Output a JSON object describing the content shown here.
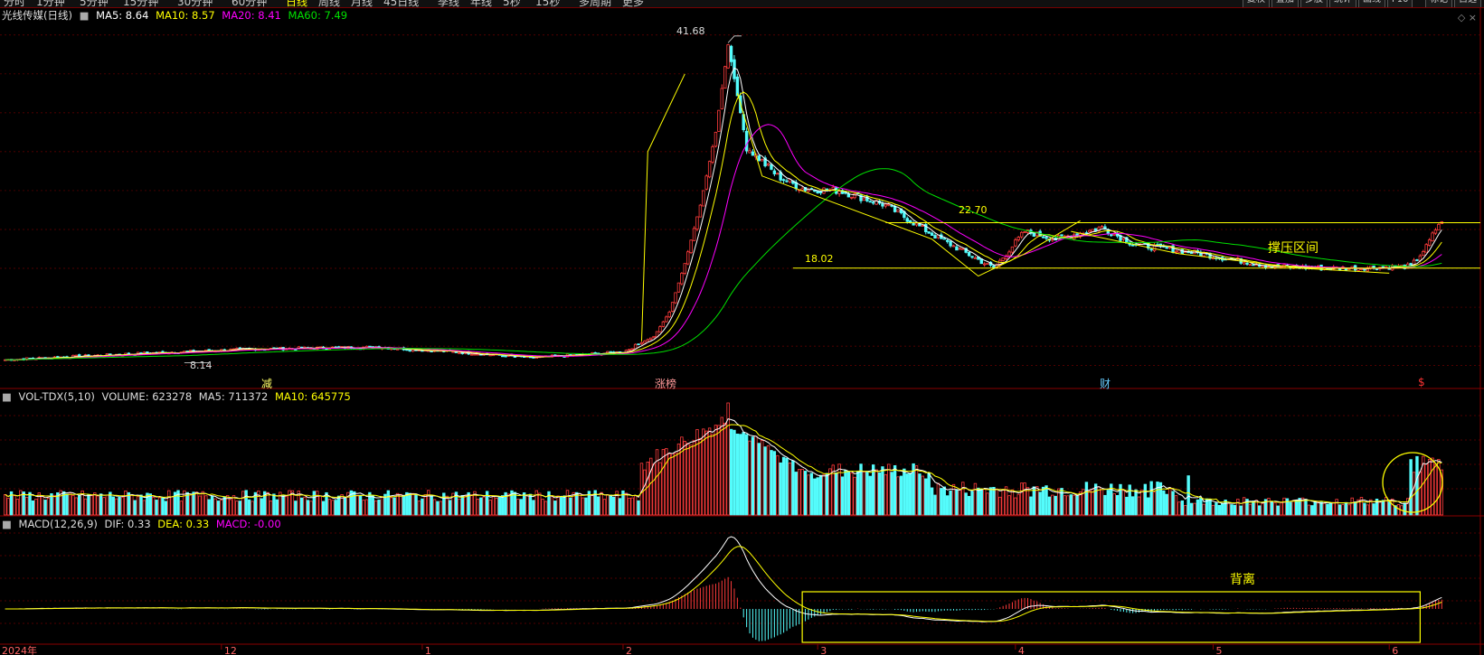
{
  "toolbar": {
    "items": [
      "分时",
      "1分钟",
      "5分钟",
      "15分钟",
      "30分钟",
      "60分钟",
      "日线",
      "周线",
      "月线",
      "45日线",
      "季线",
      "年线",
      "5秒",
      "15秒",
      "多周期",
      "更多"
    ],
    "active": "日线",
    "buttons": [
      "复权",
      "叠加",
      "多股",
      "统计",
      "画线",
      "F10",
      "标记",
      "自选"
    ]
  },
  "price_legend": {
    "symbol": "光线传媒(日线)",
    "ma5": "MA5: 8.64",
    "ma10": "MA10: 8.57",
    "ma20": "MA20: 8.41",
    "ma60": "MA60: 7.49"
  },
  "vol_legend": {
    "name": "VOL-TDX(5,10)",
    "volume": "VOLUME: 623278",
    "ma5": "MA5: 711372",
    "ma10": "MA10: 645775"
  },
  "macd_legend": {
    "name": "MACD(12,26,9)",
    "dif": "DIF: 0.33",
    "dea": "DEA: 0.33",
    "macd": "MACD: -0.00"
  },
  "annotations": {
    "high": "41.68",
    "low": "8.14",
    "level_high": "22.70",
    "level_low": "18.02",
    "zone": "撑压区间",
    "divergence": "背离",
    "marker_reduce": "减",
    "marker_top_list": "涨榜",
    "marker_finance": "财",
    "marker_dollar": "$"
  },
  "icons": [
    "diamond-icon",
    "close-icon"
  ],
  "colors": {
    "up": "#ff3c3c",
    "down": "#54fcfc",
    "ma5": "#ffffff",
    "ma10": "#ffff00",
    "ma20": "#ff00ff",
    "ma60": "#00e000",
    "annotation": "#ffff00",
    "grid": "#6b0000"
  },
  "chart_data": {
    "type": "candlestick",
    "x_axis_labels": [
      "2024年",
      "12",
      "1",
      "2",
      "3",
      "4",
      "5",
      "6"
    ],
    "price_range": [
      7.5,
      43
    ],
    "key_levels": [
      22.7,
      18.02
    ],
    "peak_close": 41.68,
    "bottom": 8.14,
    "keypoints": [
      [
        0,
        8.6
      ],
      [
        40,
        9.2
      ],
      [
        80,
        9.7
      ],
      [
        120,
        9.9
      ],
      [
        150,
        9.3
      ],
      [
        170,
        8.8
      ],
      [
        200,
        9.4
      ],
      [
        210,
        11.0
      ],
      [
        215,
        13.5
      ],
      [
        220,
        18.5
      ],
      [
        225,
        24.5
      ],
      [
        230,
        32.0
      ],
      [
        234,
        41.0
      ],
      [
        240,
        30.5
      ],
      [
        250,
        27.5
      ],
      [
        258,
        26.2
      ],
      [
        270,
        26.0
      ],
      [
        285,
        24.5
      ],
      [
        300,
        21.5
      ],
      [
        320,
        18.0
      ],
      [
        330,
        21.8
      ],
      [
        340,
        21.0
      ],
      [
        355,
        22.2
      ],
      [
        365,
        20.5
      ],
      [
        385,
        19.6
      ],
      [
        410,
        18.2
      ],
      [
        430,
        18.0
      ],
      [
        455,
        18.2
      ],
      [
        460,
        20.2
      ],
      [
        464,
        22.6
      ]
    ]
  }
}
